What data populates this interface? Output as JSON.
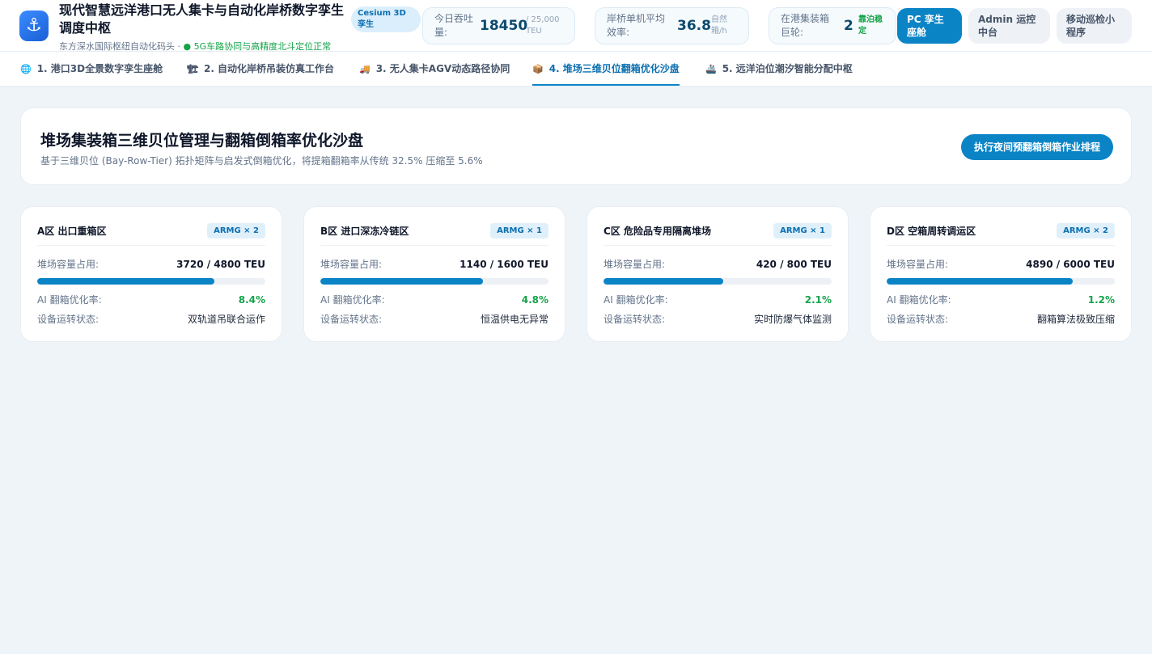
{
  "header": {
    "logo_icon": "anchor-icon",
    "title": "现代智慧远洋港口无人集卡与自动化岸桥数字孪生调度中枢",
    "subtitle_prefix": "东方深水国际枢纽自动化码头 · ",
    "subtitle_status": "● 5G车路协同与高精度北斗定位正常",
    "engine_badge": "Cesium 3D 孪生",
    "stats": [
      {
        "label": "今日吞吐量:",
        "value": "18450",
        "unit": "/ 25,000 TEU"
      },
      {
        "label": "岸桥单机平均效率:",
        "value": "36.8",
        "unit": "自然箱/h"
      },
      {
        "label": "在港集装箱巨轮:",
        "value": "2",
        "unit": "靠泊稳定"
      }
    ],
    "buttons": [
      {
        "label": "PC 孪生座舱"
      },
      {
        "label": "Admin 运控中台"
      },
      {
        "label": "移动巡检小程序"
      }
    ]
  },
  "tabs": [
    {
      "icon": "🌐",
      "icon_name": "globe-icon",
      "label": "1. 港口3D全景数字孪生座舱"
    },
    {
      "icon": "🏗",
      "icon_name": "crane-icon",
      "label": "2. 自动化岸桥吊装仿真工作台"
    },
    {
      "icon": "🚚",
      "icon_name": "truck-icon",
      "label": "3. 无人集卡AGV动态路径协同"
    },
    {
      "icon": "📦",
      "icon_name": "box-icon",
      "label": "4. 堆场三维贝位翻箱优化沙盘"
    },
    {
      "icon": "🚢",
      "icon_name": "ship-icon",
      "label": "5. 远洋泊位潮汐智能分配中枢"
    }
  ],
  "active_tab": 3,
  "hero": {
    "title": "堆场集装箱三维贝位管理与翻箱倒箱率优化沙盘",
    "subtitle": "基于三维贝位 (Bay-Row-Tier) 拓扑矩阵与启发式倒箱优化，将提箱翻箱率从传统 32.5% 压缩至 5.6%",
    "action_label": "执行夜间预翻箱倒箱作业排程"
  },
  "labels": {
    "capacity": "堆场容量占用:",
    "rehandle": "AI 翻箱优化率:",
    "status": "设备运转状态:"
  },
  "yards": [
    {
      "name": "A区 出口重箱区",
      "tag": "ARMG × 2",
      "capacity_text": "3720 / 4800 TEU",
      "capacity_ratio": 0.775,
      "rehandle": "8.4%",
      "status": "双轨道吊联合运作"
    },
    {
      "name": "B区 进口深冻冷链区",
      "tag": "ARMG × 1",
      "capacity_text": "1140 / 1600 TEU",
      "capacity_ratio": 0.7125,
      "rehandle": "4.8%",
      "status": "恒温供电无异常"
    },
    {
      "name": "C区 危险品专用隔离堆场",
      "tag": "ARMG × 1",
      "capacity_text": "420 / 800 TEU",
      "capacity_ratio": 0.525,
      "rehandle": "2.1%",
      "status": "实时防爆气体监测"
    },
    {
      "name": "D区 空箱周转调运区",
      "tag": "ARMG × 2",
      "capacity_text": "4890 / 6000 TEU",
      "capacity_ratio": 0.815,
      "rehandle": "1.2%",
      "status": "翻箱算法极致压缩"
    }
  ]
}
